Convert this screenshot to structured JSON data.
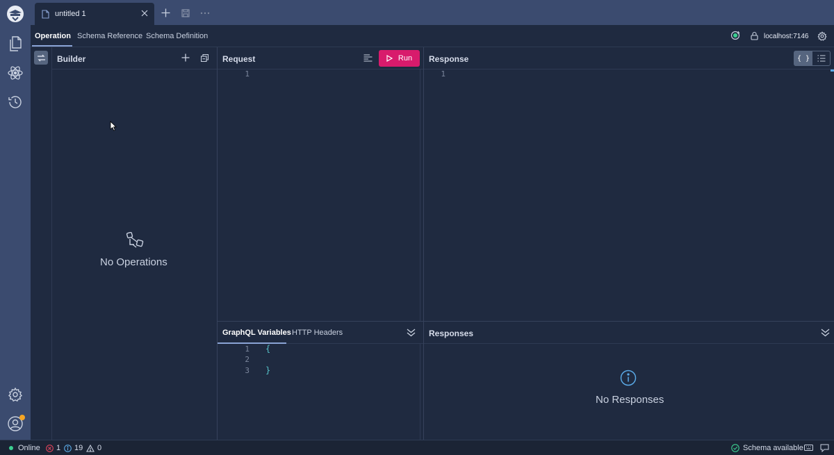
{
  "tab": {
    "title": "untitled 1"
  },
  "subtabs": {
    "operation": "Operation",
    "schema_reference": "Schema Reference",
    "schema_definition": "Schema Definition"
  },
  "server": {
    "label": "localhost:7146"
  },
  "builder": {
    "title": "Builder",
    "empty_text": "No Operations"
  },
  "request": {
    "title": "Request",
    "run_label": "Run",
    "line_numbers": [
      "1"
    ]
  },
  "response": {
    "title": "Response",
    "view_json_label": "{ }",
    "line_numbers": [
      "1"
    ]
  },
  "variables": {
    "tab_graphql": "GraphQL Variables",
    "tab_headers": "HTTP Headers",
    "line_numbers": [
      "1",
      "2",
      "3"
    ],
    "open_brace": "{",
    "close_brace": "}"
  },
  "responses": {
    "title": "Responses",
    "empty_text": "No Responses"
  },
  "status": {
    "online": "Online",
    "errors": "1",
    "infos": "19",
    "warnings": "0",
    "schema": "Schema available"
  },
  "colors": {
    "accent": "#d81b6c",
    "online": "#3ccf91",
    "error": "#e0445b",
    "info": "#5aa9e6",
    "badge": "#f5a524"
  }
}
